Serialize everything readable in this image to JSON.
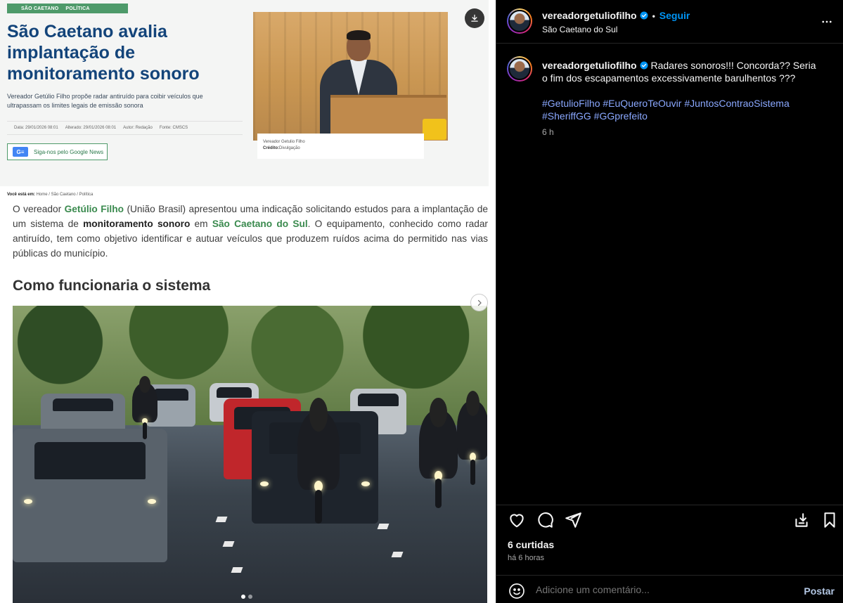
{
  "media": {
    "tag1": "SÃO CAETANO",
    "tag2": "POLÍTICA",
    "headline": "São Caetano avalia implantação de monitoramento sonoro",
    "subhead": "Vereador Getúlio Filho propõe radar antiruído para coibir veículos que ultrapassam os limites legais de emissão sonora",
    "meta": [
      "Data: 29/01/2026 08:01",
      "Alterado: 29/01/2026 08:01",
      "Autor: Redação",
      "Fonte: CMSCS"
    ],
    "gnews": "Siga-nos pelo Google News",
    "photo_caption_name": "Vereador Getulio Filho",
    "photo_caption_credit_label": "Crédito:",
    "photo_caption_credit": "Divulgação",
    "breadcrumb_label": "Você está em:",
    "breadcrumb": "Home  /  São Caetano  /  Política",
    "para_1": "O vereador ",
    "para_name": "Getúlio Filho",
    "para_2": " (União Brasil) apresentou uma indicação solicitando estudos para a implantação de um sistema de ",
    "para_bold": "monitoramento sonoro",
    "para_3": " em ",
    "para_city": "São Caetano do Sul",
    "para_4": ". O equipamento, conhecido como radar antiruído, tem como objetivo identificar e autuar veículos que produzem ruídos acima do permitido nas vias públicas do município.",
    "section_heading": "Como funcionaria o sistema",
    "carousel": {
      "index": 1,
      "total": 2
    }
  },
  "post": {
    "username": "vereadorgetuliofilho",
    "separator": "•",
    "follow_label": "Seguir",
    "location": "São Caetano do Sul",
    "caption": "Radares sonoros!!! Concorda?? Seria o fim dos escapamentos excessivamente barulhentos ???",
    "hashtags": [
      "#GetulioFilho",
      "#EuQueroTeOuvir",
      "#JuntosContraoSistema",
      "#SheriffGG",
      "#GGprefeito"
    ],
    "caption_age": "6 h",
    "likes": "6 curtidas",
    "timestamp": "há 6 horas",
    "comment_placeholder": "Adicione um comentário...",
    "post_label": "Postar"
  },
  "icons": {
    "verified": "verified-badge-icon",
    "more": "more-options-icon",
    "like": "heart-icon",
    "comment": "comment-icon",
    "share": "share-icon",
    "download": "download-icon",
    "save": "bookmark-icon",
    "emoji": "emoji-icon",
    "next": "chevron-right-icon"
  },
  "colors": {
    "follow": "#0095f6",
    "hashtag": "#8aa8ff",
    "headline": "#13447a",
    "accent_green": "#3a8a4e"
  }
}
